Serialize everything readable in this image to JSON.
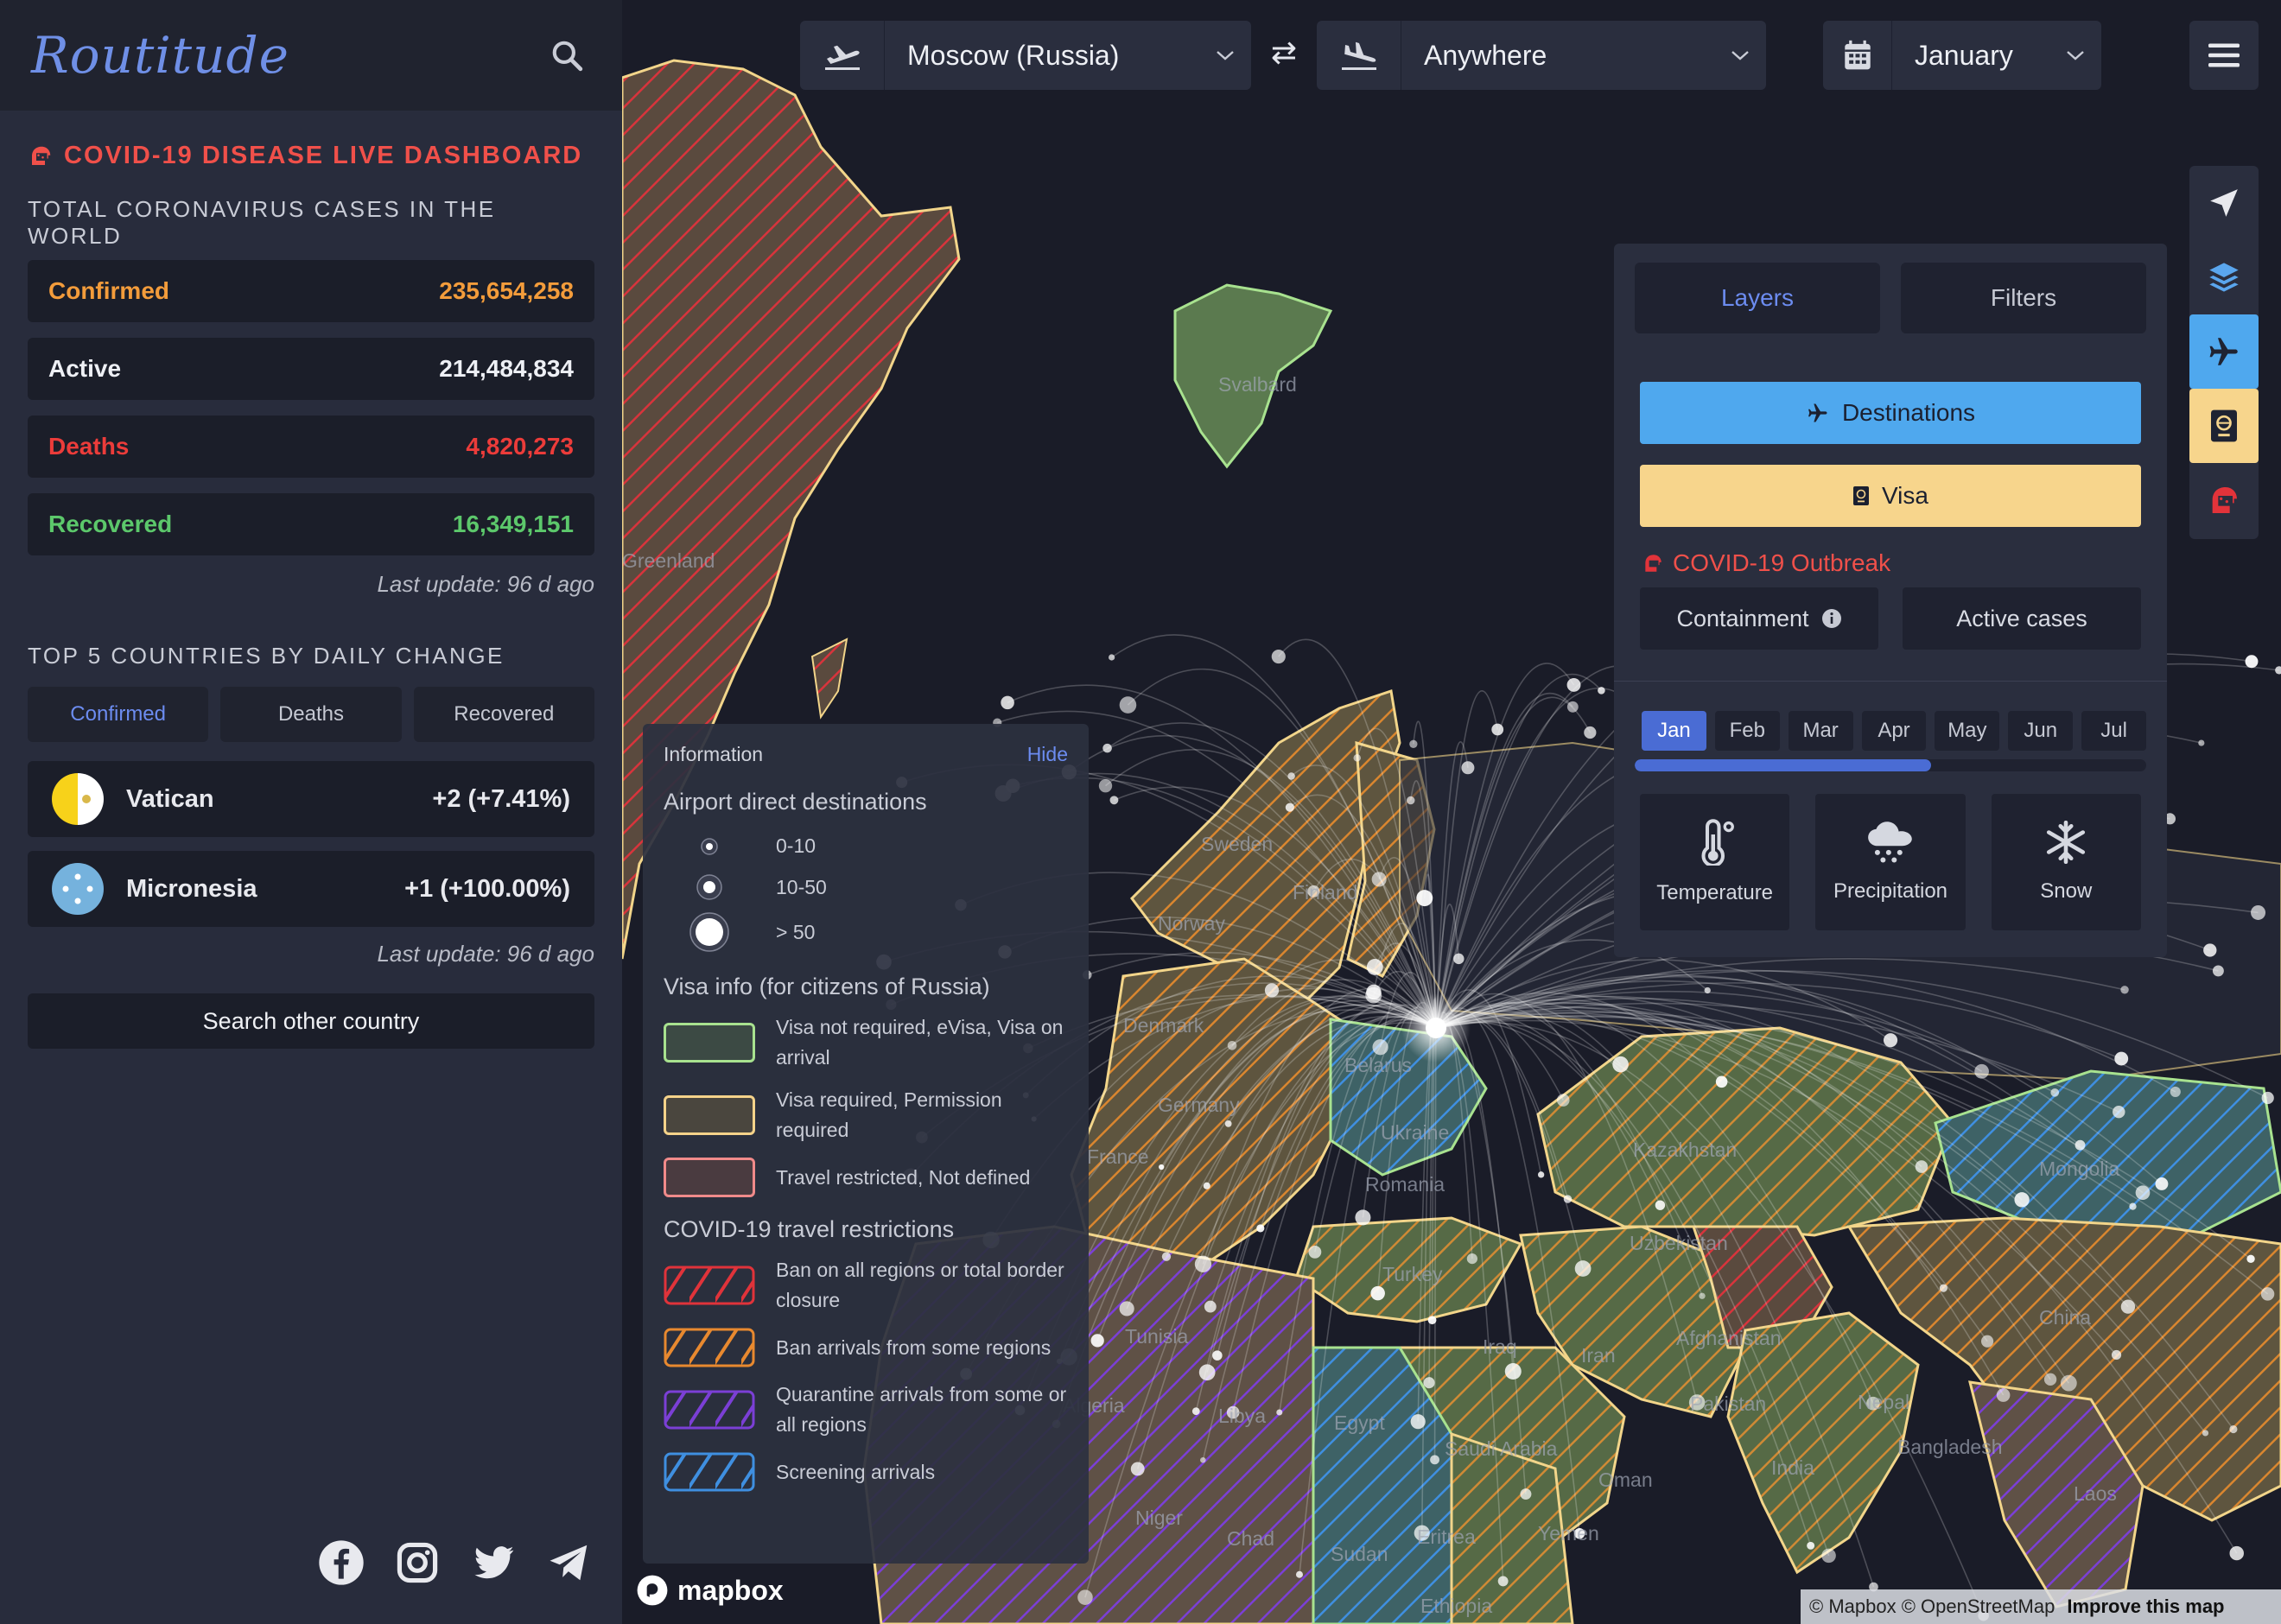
{
  "app": {
    "logo": "Routitude"
  },
  "sidebar": {
    "covid_title": "COVID-19 DISEASE LIVE DASHBOARD",
    "total_title": "TOTAL CORONAVIRUS CASES IN THE WORLD",
    "stats": [
      {
        "label": "Confirmed",
        "value": "235,654,258",
        "color": "#f39c3b"
      },
      {
        "label": "Active",
        "value": "214,484,834",
        "color": "#eef0f5"
      },
      {
        "label": "Deaths",
        "value": "4,820,273",
        "color": "#ec3c3a"
      },
      {
        "label": "Recovered",
        "value": "16,349,151",
        "color": "#5cc86b"
      }
    ],
    "last_update": "Last update: 96 d ago",
    "top5_title": "TOP 5 COUNTRIES BY DAILY CHANGE",
    "tabs": [
      "Confirmed",
      "Deaths",
      "Recovered"
    ],
    "countries": [
      {
        "name": "Vatican",
        "change": "+2 (+7.41%)"
      },
      {
        "name": "Micronesia",
        "change": "+1 (+100.00%)"
      }
    ],
    "last_update2": "Last update: 96 d ago",
    "search_country": "Search other country"
  },
  "topbar": {
    "from": "Moscow (Russia)",
    "to": "Anywhere",
    "month": "January",
    "swap_icon": "⇄"
  },
  "layers_panel": {
    "tabs": [
      "Layers",
      "Filters"
    ],
    "destinations": "Destinations",
    "visa": "Visa",
    "outbreak": "COVID-19 Outbreak",
    "containment": "Containment",
    "active_cases": "Active cases",
    "months": [
      "Jan",
      "Feb",
      "Mar",
      "Apr",
      "May",
      "Jun",
      "Jul"
    ],
    "month_progress": 0.58,
    "climate": [
      "Temperature",
      "Precipitation",
      "Snow"
    ]
  },
  "info_panel": {
    "title": "Information",
    "hide": "Hide",
    "airport_title": "Airport direct destinations",
    "airport_sizes": [
      "0-10",
      "10-50",
      "> 50"
    ],
    "visa_title": "Visa info (for citizens of Russia)",
    "visa_items": [
      {
        "text": "Visa not required, eVisa, Visa on arrival",
        "color": "#a8e28f"
      },
      {
        "text": "Visa required, Permission required",
        "color": "#f5d38a"
      },
      {
        "text": "Travel restricted, Not defined",
        "color": "#f08a8a"
      }
    ],
    "covid_title": "COVID-19 travel restrictions",
    "covid_items": [
      {
        "text": "Ban on all regions or total border closure",
        "color": "#e0333a"
      },
      {
        "text": "Ban arrivals from some regions",
        "color": "#e8892f"
      },
      {
        "text": "Quarantine arrivals from some or all regions",
        "color": "#7b3fd6"
      },
      {
        "text": "Screening arrivals",
        "color": "#3f8fe0"
      }
    ]
  },
  "map": {
    "labels": [
      "Svalbard",
      "Greenland",
      "Sweden",
      "Finland",
      "Norway",
      "Ukraine",
      "Kazakhstan",
      "Mongolia",
      "China",
      "Turkey",
      "Iran",
      "Iraq",
      "Afghanistan",
      "Pakistan",
      "India",
      "Saudi Arabia",
      "Egypt",
      "Libya",
      "Algeria",
      "Tunisia",
      "Niger",
      "Chad",
      "Sudan",
      "Yemen",
      "Oman",
      "Eritrea",
      "Ethiopia",
      "Laos",
      "Bangladesh",
      "Nepal",
      "Romania",
      "Denmark",
      "France",
      "Germany",
      "Belarus",
      "Uzbekistan"
    ],
    "mapbox": "mapbox",
    "attribution": "© Mapbox © OpenStreetMap",
    "improve": "Improve this map"
  }
}
